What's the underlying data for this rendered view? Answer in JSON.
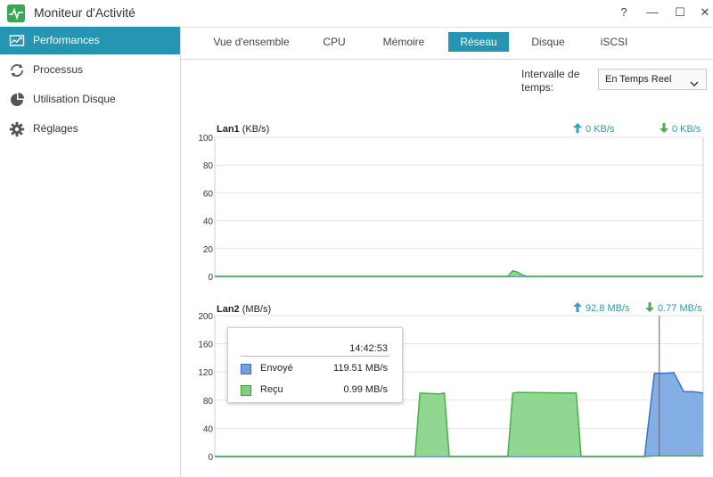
{
  "window": {
    "title": "Moniteur d'Activité",
    "help_glyph": "?",
    "minimize_glyph": "—",
    "maximize_glyph": "☐",
    "close_glyph": "✕"
  },
  "sidebar": {
    "items": [
      {
        "label": "Performances",
        "icon": "performance-icon",
        "active": true
      },
      {
        "label": "Processus",
        "icon": "refresh-icon",
        "active": false
      },
      {
        "label": "Utilisation Disque",
        "icon": "pie-icon",
        "active": false
      },
      {
        "label": "Réglages",
        "icon": "gear-icon",
        "active": false
      }
    ]
  },
  "tabs": [
    {
      "label": "Vue d'ensemble",
      "active": false
    },
    {
      "label": "CPU",
      "active": false
    },
    {
      "label": "Mémoire",
      "active": false
    },
    {
      "label": "Réseau",
      "active": true
    },
    {
      "label": "Disque",
      "active": false
    },
    {
      "label": "iSCSI",
      "active": false
    }
  ],
  "interval": {
    "label": "Intervalle de temps:",
    "selected": "En Temps Reel"
  },
  "colors": {
    "accent": "#2496b3",
    "sent": "#6fa1e0",
    "received": "#7ed07e",
    "cursor": "#d9342b"
  },
  "lan1": {
    "name": "Lan1",
    "unit": "(KB/s)",
    "sent": "0 KB/s",
    "received": "0 KB/s"
  },
  "lan2": {
    "name": "Lan2",
    "unit": "(MB/s)",
    "sent": "92.8 MB/s",
    "received": "0.77 MB/s"
  },
  "tooltip": {
    "time": "14:42:53",
    "rows": [
      {
        "name": "Envoyé",
        "value": "119.51 MB/s"
      },
      {
        "name": "Reçu",
        "value": "0.99 MB/s"
      }
    ]
  },
  "chart_data": [
    {
      "type": "area",
      "title": "Lan1",
      "ylabel": "(KB/s)",
      "ylim": [
        0,
        100
      ],
      "yticks": [
        0,
        20,
        40,
        60,
        80,
        100
      ],
      "x": [
        0,
        50,
        60,
        61,
        62,
        63,
        64,
        100
      ],
      "series": [
        {
          "name": "Envoyé",
          "values": [
            0,
            0,
            0,
            0,
            0,
            0,
            0,
            0
          ]
        },
        {
          "name": "Reçu",
          "values": [
            0,
            0,
            0,
            4,
            3,
            1,
            0,
            0
          ]
        }
      ]
    },
    {
      "type": "area",
      "title": "Lan2",
      "ylabel": "(MB/s)",
      "ylim": [
        0,
        200
      ],
      "yticks": [
        0,
        40,
        80,
        120,
        160,
        200
      ],
      "x": [
        0,
        35,
        41,
        42,
        46,
        47,
        48,
        60,
        61,
        62,
        74,
        75,
        76,
        84,
        85,
        86,
        88,
        90,
        92,
        94,
        96,
        98,
        100
      ],
      "series": [
        {
          "name": "Envoyé",
          "values": [
            0,
            0,
            0,
            0,
            0,
            0,
            0,
            0,
            0,
            0,
            0,
            0,
            0,
            0,
            0,
            0,
            0,
            118,
            118,
            119,
            92,
            92,
            90
          ]
        },
        {
          "name": "Reçu",
          "values": [
            0,
            0,
            0,
            90,
            89,
            90,
            0,
            0,
            90,
            91,
            90,
            0,
            0,
            0,
            0,
            0,
            0,
            1,
            1,
            1,
            1,
            1,
            1
          ]
        }
      ]
    }
  ]
}
